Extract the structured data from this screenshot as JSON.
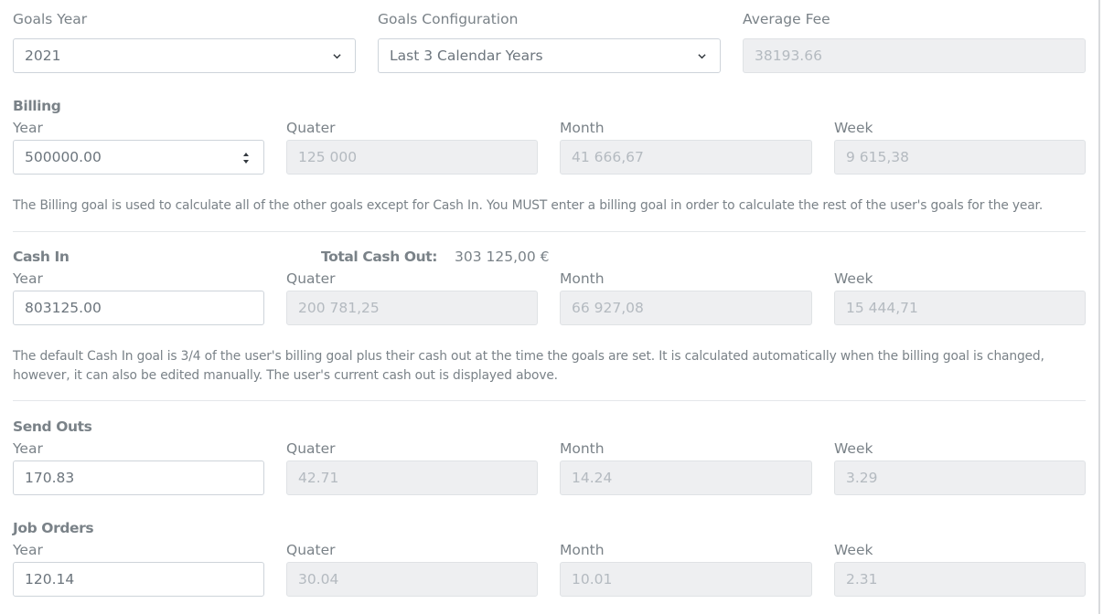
{
  "top": {
    "goals_year": {
      "label": "Goals Year",
      "value": "2021"
    },
    "goals_config": {
      "label": "Goals Configuration",
      "value": "Last 3 Calendar Years"
    },
    "average_fee": {
      "label": "Average Fee",
      "value": "38193.66"
    }
  },
  "billing": {
    "title": "Billing",
    "year_label": "Year",
    "year": "500000.00",
    "quarter_label": "Quater",
    "quarter": "125 000",
    "month_label": "Month",
    "month": "41 666,67",
    "week_label": "Week",
    "week": "9 615,38",
    "help": "The Billing goal is used to calculate all of the other goals except for Cash In. You MUST enter a billing goal in order to calculate the rest of the user's goals for the year."
  },
  "cash_in": {
    "title": "Cash In",
    "total_cash_out_label": "Total Cash Out:",
    "total_cash_out": "303 125,00 €",
    "year_label": "Year",
    "year": "803125.00",
    "quarter_label": "Quater",
    "quarter": "200 781,25",
    "month_label": "Month",
    "month": "66 927,08",
    "week_label": "Week",
    "week": "15 444,71",
    "help_line1": "The default Cash In goal is 3/4 of the user's billing goal plus their cash out at the time the goals are set. It is calculated automatically when the billing goal is changed,",
    "help_line2": "however, it can also be edited manually. The user's current cash out is displayed above."
  },
  "send_outs": {
    "title": "Send Outs",
    "year_label": "Year",
    "year": "170.83",
    "quarter_label": "Quater",
    "quarter": "42.71",
    "month_label": "Month",
    "month": "14.24",
    "week_label": "Week",
    "week": "3.29"
  },
  "job_orders": {
    "title": "Job Orders",
    "year_label": "Year",
    "year": "120.14",
    "quarter_label": "Quater",
    "quarter": "30.04",
    "month_label": "Month",
    "month": "10.01",
    "week_label": "Week",
    "week": "2.31"
  },
  "icons": {
    "select_arrow": "chevron-down-icon",
    "number_spinner": "spinner-icon"
  }
}
